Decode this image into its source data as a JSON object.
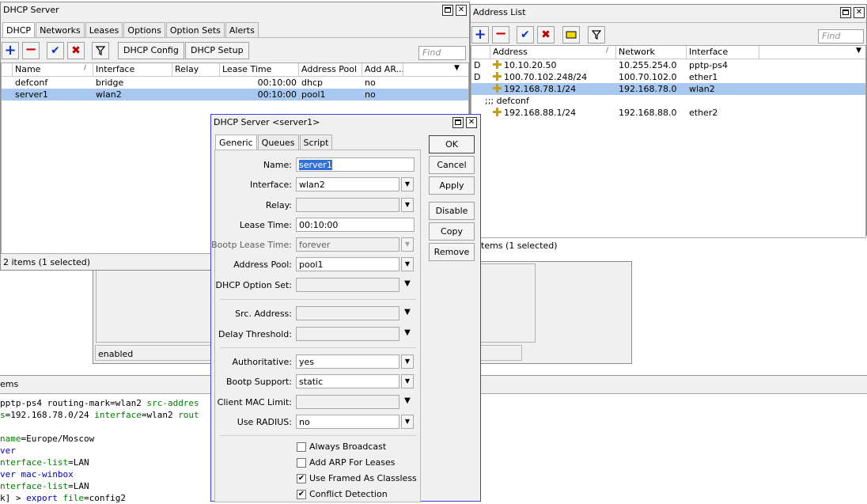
{
  "dhcp_window": {
    "title": "DHCP Server",
    "tabs": [
      "DHCP",
      "Networks",
      "Leases",
      "Options",
      "Option Sets",
      "Alerts"
    ],
    "buttons": {
      "config": "DHCP Config",
      "setup": "DHCP Setup"
    },
    "find_placeholder": "Find",
    "columns": [
      "Name",
      "Interface",
      "Relay",
      "Lease Time",
      "Address Pool",
      "Add AR..."
    ],
    "rows": [
      {
        "name": "defconf",
        "interface": "bridge",
        "relay": "",
        "lease_time": "00:10:00",
        "address_pool": "dhcp",
        "add_arp": "no"
      },
      {
        "name": "server1",
        "interface": "wlan2",
        "relay": "",
        "lease_time": "00:10:00",
        "address_pool": "pool1",
        "add_arp": "no"
      }
    ],
    "status": "2 items (1 selected)"
  },
  "back_window": {
    "status": "enabled"
  },
  "address_window": {
    "title": "Address List",
    "find_placeholder": "Find",
    "columns": [
      "Address",
      "Network",
      "Interface"
    ],
    "rows": [
      {
        "flag": "D",
        "address": "10.10.20.50",
        "network": "10.255.254.0",
        "interface": "pptp-ps4"
      },
      {
        "flag": "D",
        "address": "100.70.102.248/24",
        "network": "100.70.102.0",
        "interface": "ether1"
      },
      {
        "flag": "",
        "address": "192.168.78.1/24",
        "network": "192.168.78.0",
        "interface": "wlan2"
      },
      {
        "comment": ";;; defconf"
      },
      {
        "flag": "",
        "address": "192.168.88.1/24",
        "network": "192.168.88.0",
        "interface": "ether2"
      }
    ],
    "status": "tems (1 selected)"
  },
  "terminal": {
    "header": "ems",
    "lines": [
      [
        {
          "t": "pptp-ps4 routing-mark",
          "c": ""
        },
        {
          "t": "=",
          "c": ""
        },
        {
          "t": "wlan2 ",
          "c": ""
        },
        {
          "t": "src-addres",
          "c": "green"
        }
      ],
      [
        {
          "t": "s",
          "c": "green"
        },
        {
          "t": "=192.168.78.0/24 ",
          "c": ""
        },
        {
          "t": "interface",
          "c": "green"
        },
        {
          "t": "=wlan2 ",
          "c": ""
        },
        {
          "t": "rout",
          "c": "green"
        }
      ],
      [
        {
          "t": "",
          "c": ""
        }
      ],
      [
        {
          "t": "name",
          "c": "green"
        },
        {
          "t": "=Europe/Moscow",
          "c": ""
        }
      ],
      [
        {
          "t": "ver",
          "c": "blue"
        }
      ],
      [
        {
          "t": "nterface-list",
          "c": "green"
        },
        {
          "t": "=LAN",
          "c": ""
        }
      ],
      [
        {
          "t": "ver mac-winbox",
          "c": "blue"
        }
      ],
      [
        {
          "t": "nterface-list",
          "c": "green"
        },
        {
          "t": "=LAN",
          "c": ""
        }
      ],
      [
        {
          "t": "k] > ",
          "c": ""
        },
        {
          "t": "export ",
          "c": "blue"
        },
        {
          "t": "file",
          "c": "green"
        },
        {
          "t": "=config2",
          "c": ""
        }
      ]
    ]
  },
  "dialog": {
    "title": "DHCP Server <server1>",
    "tabs": [
      "Generic",
      "Queues",
      "Script"
    ],
    "labels": {
      "name": "Name:",
      "interface": "Interface:",
      "relay": "Relay:",
      "lease_time": "Lease Time:",
      "bootp_lease_time": "Bootp Lease Time:",
      "address_pool": "Address Pool:",
      "dhcp_option_set": "DHCP Option Set:",
      "src_address": "Src. Address:",
      "delay_threshold": "Delay Threshold:",
      "authoritative": "Authoritative:",
      "bootp_support": "Bootp Support:",
      "client_mac_limit": "Client MAC Limit:",
      "use_radius": "Use RADIUS:"
    },
    "values": {
      "name": "server1",
      "interface": "wlan2",
      "relay": "",
      "lease_time": "00:10:00",
      "bootp_lease_time": "forever",
      "address_pool": "pool1",
      "dhcp_option_set": "",
      "src_address": "",
      "delay_threshold": "",
      "authoritative": "yes",
      "bootp_support": "static",
      "client_mac_limit": "",
      "use_radius": "no"
    },
    "checkboxes": [
      {
        "label": "Always Broadcast",
        "checked": false
      },
      {
        "label": "Add ARP For Leases",
        "checked": false
      },
      {
        "label": "Use Framed As Classless",
        "checked": true
      },
      {
        "label": "Conflict Detection",
        "checked": true
      }
    ],
    "buttons": {
      "ok": "OK",
      "cancel": "Cancel",
      "apply": "Apply",
      "disable": "Disable",
      "copy": "Copy",
      "remove": "Remove"
    }
  }
}
